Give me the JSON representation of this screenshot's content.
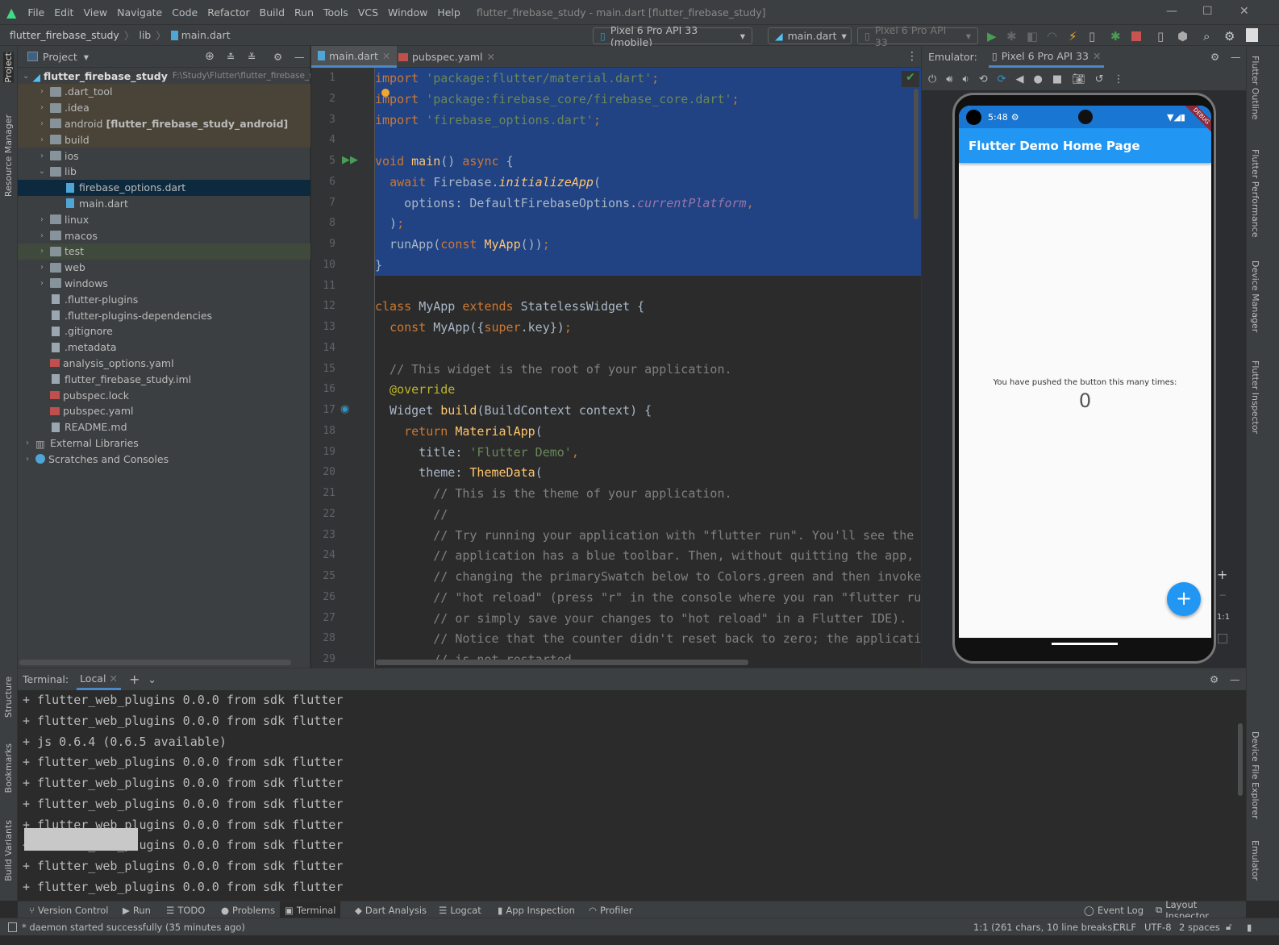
{
  "window": {
    "title": "flutter_firebase_study - main.dart [flutter_firebase_study]"
  },
  "menu": [
    "File",
    "Edit",
    "View",
    "Navigate",
    "Code",
    "Refactor",
    "Build",
    "Run",
    "Tools",
    "VCS",
    "Window",
    "Help"
  ],
  "breadcrumb": [
    "flutter_firebase_study",
    "lib",
    "main.dart"
  ],
  "toolbar": {
    "device": "Pixel 6 Pro API 33 (mobile)",
    "run_config": "main.dart",
    "target_device": "Pixel 6 Pro API 33"
  },
  "left_stripe": [
    "Project",
    "Resource Manager",
    "Structure",
    "Bookmarks",
    "Build Variants"
  ],
  "right_stripe": [
    "Flutter Outline",
    "Flutter Performance",
    "Device Manager",
    "Flutter Inspector",
    "Device File Explorer",
    "Emulator"
  ],
  "project": {
    "title": "Project",
    "tree": [
      {
        "label": "flutter_firebase_study",
        "extra": "F:\\Study\\Flutter\\flutter_firebase_study",
        "level": 0,
        "arrow": "down",
        "icon": "flutter",
        "bg": ""
      },
      {
        "label": ".dart_tool",
        "level": 1,
        "arrow": "right",
        "icon": "folder",
        "bg": "#4a4438"
      },
      {
        "label": ".idea",
        "level": 1,
        "arrow": "right",
        "icon": "folder",
        "bg": "#4a4438"
      },
      {
        "label": "android",
        "extra": "[flutter_firebase_study_android]",
        "level": 1,
        "arrow": "right",
        "icon": "folder",
        "bg": "#4a4438"
      },
      {
        "label": "build",
        "level": 1,
        "arrow": "right",
        "icon": "folder",
        "bg": "#4a4438"
      },
      {
        "label": "ios",
        "level": 1,
        "arrow": "right",
        "icon": "folder",
        "bg": ""
      },
      {
        "label": "lib",
        "level": 1,
        "arrow": "down",
        "icon": "folder",
        "bg": ""
      },
      {
        "label": "firebase_options.dart",
        "level": 2,
        "arrow": "",
        "icon": "dart",
        "bg": "#0d293e"
      },
      {
        "label": "main.dart",
        "level": 2,
        "arrow": "",
        "icon": "dart",
        "bg": ""
      },
      {
        "label": "linux",
        "level": 1,
        "arrow": "right",
        "icon": "folder",
        "bg": ""
      },
      {
        "label": "macos",
        "level": 1,
        "arrow": "right",
        "icon": "folder",
        "bg": ""
      },
      {
        "label": "test",
        "level": 1,
        "arrow": "right",
        "icon": "folder",
        "bg": "#3f4a3c"
      },
      {
        "label": "web",
        "level": 1,
        "arrow": "right",
        "icon": "folder",
        "bg": ""
      },
      {
        "label": "windows",
        "level": 1,
        "arrow": "right",
        "icon": "folder",
        "bg": ""
      },
      {
        "label": ".flutter-plugins",
        "level": 1,
        "arrow": "",
        "icon": "file",
        "bg": ""
      },
      {
        "label": ".flutter-plugins-dependencies",
        "level": 1,
        "arrow": "",
        "icon": "file",
        "bg": ""
      },
      {
        "label": ".gitignore",
        "level": 1,
        "arrow": "",
        "icon": "file",
        "bg": ""
      },
      {
        "label": ".metadata",
        "level": 1,
        "arrow": "",
        "icon": "file",
        "bg": ""
      },
      {
        "label": "analysis_options.yaml",
        "level": 1,
        "arrow": "",
        "icon": "yml",
        "bg": ""
      },
      {
        "label": "flutter_firebase_study.iml",
        "level": 1,
        "arrow": "",
        "icon": "file",
        "bg": ""
      },
      {
        "label": "pubspec.lock",
        "level": 1,
        "arrow": "",
        "icon": "yml",
        "bg": ""
      },
      {
        "label": "pubspec.yaml",
        "level": 1,
        "arrow": "",
        "icon": "yml",
        "bg": ""
      },
      {
        "label": "README.md",
        "level": 1,
        "arrow": "",
        "icon": "file",
        "bg": ""
      },
      {
        "label": "External Libraries",
        "level": 0,
        "arrow": "right",
        "icon": "lib",
        "bg": ""
      },
      {
        "label": "Scratches and Consoles",
        "level": 0,
        "arrow": "right",
        "icon": "scratch",
        "bg": ""
      }
    ]
  },
  "editor": {
    "tabs": [
      "main.dart",
      "pubspec.yaml"
    ],
    "selected_lines": 10,
    "lines": [
      [
        [
          "kw",
          "import"
        ],
        [
          "str",
          " 'package:flutter/material.dart'"
        ],
        [
          "kw",
          ";"
        ]
      ],
      [
        [
          "kw",
          "import"
        ],
        [
          "str",
          " 'package:firebase_core/firebase_core.dart'"
        ],
        [
          "kw",
          ";"
        ]
      ],
      [
        [
          "kw",
          "import"
        ],
        [
          "str",
          " 'firebase_options.dart'"
        ],
        [
          "kw",
          ";"
        ]
      ],
      [],
      [
        [
          "kw",
          "void "
        ],
        [
          "fn",
          "main"
        ],
        [
          "",
          "() "
        ],
        [
          "kw",
          "async"
        ],
        [
          "",
          " {"
        ]
      ],
      [
        [
          "",
          "  "
        ],
        [
          "kw",
          "await"
        ],
        [
          "",
          " Firebase."
        ],
        [
          "it",
          "initializeApp"
        ],
        [
          "",
          "("
        ]
      ],
      [
        [
          "",
          "    options: DefaultFirebaseOptions."
        ],
        [
          "pp",
          "currentPlatform"
        ],
        [
          "kw",
          ","
        ]
      ],
      [
        [
          "",
          "  )"
        ],
        [
          "kw",
          ";"
        ]
      ],
      [
        [
          "",
          "  runApp("
        ],
        [
          "kw",
          "const "
        ],
        [
          "fn",
          "MyApp"
        ],
        [
          "",
          "())"
        ],
        [
          "kw",
          ";"
        ]
      ],
      [
        [
          "",
          "}"
        ]
      ],
      [],
      [
        [
          "kw",
          "class "
        ],
        [
          "",
          "MyApp "
        ],
        [
          "kw",
          "extends "
        ],
        [
          "",
          "StatelessWidget {"
        ]
      ],
      [
        [
          "",
          "  "
        ],
        [
          "kw",
          "const "
        ],
        [
          "",
          "MyApp({"
        ],
        [
          "kw",
          "super"
        ],
        [
          "",
          ".key})"
        ],
        [
          "kw",
          ";"
        ]
      ],
      [],
      [
        [
          "cm",
          "  // This widget is the root of your application."
        ]
      ],
      [
        [
          "ann",
          "  @override"
        ]
      ],
      [
        [
          "",
          "  Widget "
        ],
        [
          "fn",
          "build"
        ],
        [
          "",
          "(BuildContext context) {"
        ]
      ],
      [
        [
          "kw",
          "    return "
        ],
        [
          "fn",
          "MaterialApp"
        ],
        [
          "",
          "("
        ]
      ],
      [
        [
          "",
          "      title: "
        ],
        [
          "str",
          "'Flutter Demo'"
        ],
        [
          "kw",
          ","
        ]
      ],
      [
        [
          "",
          "      theme: "
        ],
        [
          "fn",
          "ThemeData"
        ],
        [
          "",
          "("
        ]
      ],
      [
        [
          "cm",
          "        // This is the theme of your application."
        ]
      ],
      [
        [
          "cm",
          "        //"
        ]
      ],
      [
        [
          "cm",
          "        // Try running your application with \"flutter run\". You'll see the"
        ]
      ],
      [
        [
          "cm",
          "        // application has a blue toolbar. Then, without quitting the app, t"
        ]
      ],
      [
        [
          "cm",
          "        // changing the primarySwatch below to Colors.green and then invoke"
        ]
      ],
      [
        [
          "cm",
          "        // \"hot reload\" (press \"r\" in the console where you ran \"flutter run"
        ]
      ],
      [
        [
          "cm",
          "        // or simply save your changes to \"hot reload\" in a Flutter IDE)."
        ]
      ],
      [
        [
          "cm",
          "        // Notice that the counter didn't reset back to zero; the applicatio"
        ]
      ],
      [
        [
          "cm",
          "        // is not restarted."
        ]
      ]
    ]
  },
  "emulator": {
    "label": "Emulator:",
    "tab": "Pixel 6 Pro API 33",
    "zoom_controls": [
      "+",
      "−",
      "1:1"
    ],
    "phone": {
      "time": "5:48",
      "debug_banner": "DEBUG",
      "appbar_title": "Flutter Demo Home Page",
      "message": "You have pushed the button this many times:",
      "counter": "0",
      "fab": "+",
      "appbar_color": "#2196f3"
    }
  },
  "terminal": {
    "label": "Terminal:",
    "tab": "Local",
    "lines": [
      "+ flutter_web_plugins 0.0.0 from sdk flutter",
      "+ flutter_web_plugins 0.0.0 from sdk flutter",
      "+ js 0.6.4 (0.6.5 available)",
      "+ flutter_web_plugins 0.0.0 from sdk flutter",
      "+ flutter_web_plugins 0.0.0 from sdk flutter",
      "+ flutter_web_plugins 0.0.0 from sdk flutter",
      "+ flutter_web_plugins 0.0.0 from sdk flutter",
      "+ flutter_web_plugins 0.0.0 from sdk flutter",
      "+ flutter_web_plugins 0.0.0 from sdk flutter",
      "+ flutter_web_plugins 0.0.0 from sdk flutter"
    ]
  },
  "tool_tabs": {
    "left": [
      "Version Control",
      "Run",
      "TODO",
      "Problems",
      "Terminal",
      "Dart Analysis",
      "Logcat",
      "App Inspection",
      "Profiler"
    ],
    "active": "Terminal",
    "right": [
      "Event Log",
      "Layout Inspector"
    ]
  },
  "status": {
    "message": "* daemon started successfully (35 minutes ago)",
    "position": "1:1 (261 chars, 10 line breaks)",
    "line_sep": "CRLF",
    "encoding": "UTF-8",
    "indent": "2 spaces"
  }
}
